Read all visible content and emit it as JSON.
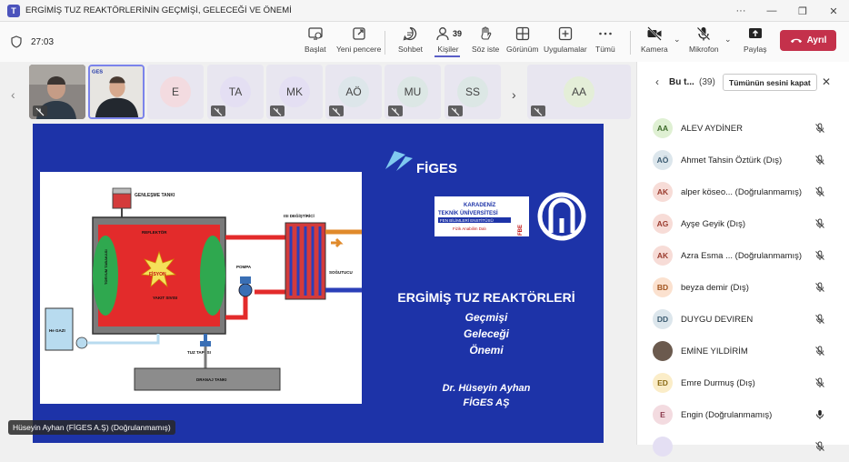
{
  "window": {
    "title": "ERGİMİŞ TUZ REAKTÖRLERİNİN GEÇMİŞİ, GELECEĞİ VE ÖNEMİ"
  },
  "toolbar": {
    "timer": "27:03",
    "buttons": {
      "start": "Başlat",
      "new_window": "Yeni pencere",
      "chat": "Sohbet",
      "people": "Kişiler",
      "people_count": "39",
      "raise_hand": "Söz iste",
      "view": "Görünüm",
      "apps": "Uygulamalar",
      "more": "Tümü",
      "camera": "Kamera",
      "mic": "Mikrofon",
      "share": "Paylaş",
      "leave": "Ayrıl"
    }
  },
  "thumbnails": [
    {
      "initials": "",
      "type": "video"
    },
    {
      "initials": "",
      "type": "video"
    },
    {
      "initials": "E",
      "color": "#f3dbe0"
    },
    {
      "initials": "TA",
      "color": "#e4dff3"
    },
    {
      "initials": "MK",
      "color": "#e4dff3"
    },
    {
      "initials": "AÖ",
      "color": "#dde6ea"
    },
    {
      "initials": "MU",
      "color": "#dce7e5"
    },
    {
      "initials": "SS",
      "color": "#dce7e5"
    },
    {
      "initials": "AA",
      "color": "#e4eed8"
    }
  ],
  "stage": {
    "speaker_label": "Hüseyin Ayhan (FİGES A.Ş) (Doğrulanmamış)",
    "slide": {
      "logo_text": "FİGES",
      "uni_line1": "KARADENİZ",
      "uni_line2": "TEKNİK ÜNİVERSİTESİ",
      "uni_line3": "FEN BİLİMLERİ ENSTİTÜSÜ",
      "uni_line4": "Fizik Anabilim Dalı",
      "uni_fbe": "FBE",
      "title": "ERGİMİŞ TUZ REAKTÖRLERİ",
      "sub1": "Geçmişi",
      "sub2": "Geleceği",
      "sub3": "Önemi",
      "author": "Dr. Hüseyin Ayhan",
      "company": "FİGES AŞ",
      "diagram": {
        "expansion_tank": "GENLEŞME TANKI",
        "reflector": "REFLEKTÖR",
        "breeding": "TORYUM TABAKASI",
        "fission": "FİSYON",
        "fuel": "YAKIT SIVISI",
        "heat_exchanger": "ISI DEĞİŞTİRİCİ",
        "pump": "POMPA",
        "cooler": "SOĞUTUCU",
        "salt_plug": "TUZ TAPASI",
        "he_gas": "He GAZI",
        "drain_tank": "DRANAJ TANKI"
      }
    }
  },
  "panel": {
    "title": "Bu t...",
    "count": "(39)",
    "mute_all": "Tümünün sesini kapat",
    "participants": [
      {
        "initials": "AA",
        "name": "ALEV AYDİNER",
        "color": "#dff0d3",
        "fg": "#3d6b2a",
        "mic": "muted"
      },
      {
        "initials": "AÖ",
        "name": "Ahmet Tahsin Öztürk (Dış)",
        "color": "#dce6ec",
        "fg": "#3a5a70",
        "mic": "muted"
      },
      {
        "initials": "AK",
        "name": "alper köseo... (Doğrulanmamış)",
        "color": "#f7dcd7",
        "fg": "#9a3b2e",
        "mic": "muted"
      },
      {
        "initials": "AG",
        "name": "Ayşe Geyik (Dış)",
        "color": "#f7dcd7",
        "fg": "#9a3b2e",
        "mic": "muted"
      },
      {
        "initials": "AK",
        "name": "Azra Esma ... (Doğrulanmamış)",
        "color": "#f7dcd7",
        "fg": "#9a3b2e",
        "mic": "muted"
      },
      {
        "initials": "BD",
        "name": "beyza demir (Dış)",
        "color": "#fbe1cf",
        "fg": "#a1531c",
        "mic": "muted"
      },
      {
        "initials": "DD",
        "name": "DUYGU DEVIREN",
        "color": "#dce6ec",
        "fg": "#3a5a70",
        "mic": "muted"
      },
      {
        "initials": "",
        "name": "EMİNE YILDİRİM",
        "color": "#6b5a4e",
        "fg": "#fff",
        "mic": "muted"
      },
      {
        "initials": "ED",
        "name": "Emre Durmuş (Dış)",
        "color": "#fbedc8",
        "fg": "#8a6a14",
        "mic": "muted"
      },
      {
        "initials": "E",
        "name": "Engin (Doğrulanmamış)",
        "color": "#f3dbe0",
        "fg": "#8a3a4c",
        "mic": "on"
      },
      {
        "initials": "",
        "name": "",
        "color": "#e4dff3",
        "fg": "#444",
        "mic": "muted"
      }
    ]
  }
}
